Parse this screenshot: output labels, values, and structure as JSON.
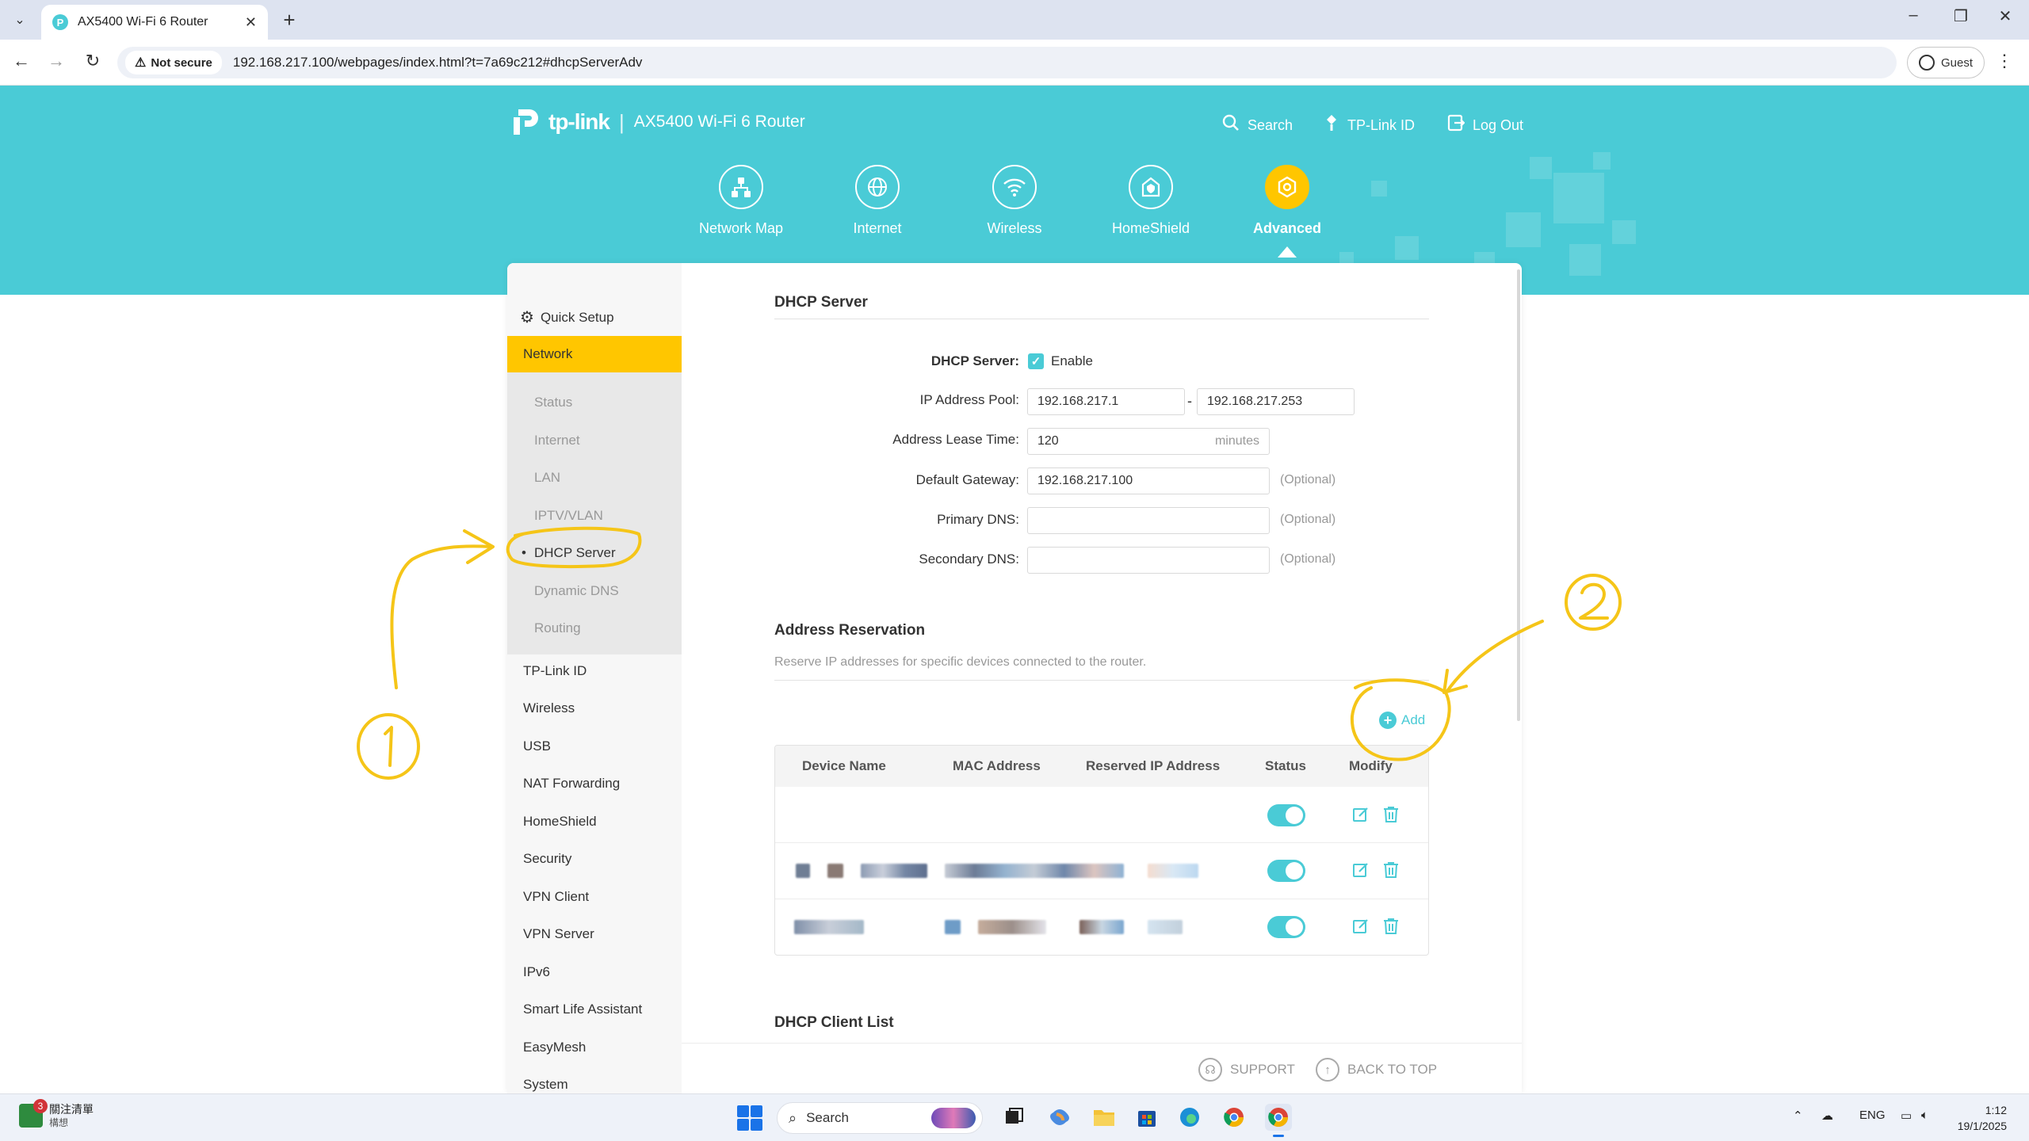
{
  "browser": {
    "tab_title": "AX5400 Wi-Fi 6 Router",
    "favicon_letter": "P",
    "security_label": "Not secure",
    "url": "192.168.217.100/webpages/index.html?t=7a69c212#dhcpServerAdv",
    "profile_label": "Guest"
  },
  "router": {
    "brand": "tp-link",
    "model": "AX5400 Wi-Fi 6 Router",
    "header_links": {
      "search": "Search",
      "tplink_id": "TP-Link ID",
      "logout": "Log Out"
    },
    "nav": [
      {
        "label": "Network Map",
        "icon": "network-map-icon"
      },
      {
        "label": "Internet",
        "icon": "globe-icon"
      },
      {
        "label": "Wireless",
        "icon": "wifi-icon"
      },
      {
        "label": "HomeShield",
        "icon": "homeshield-icon"
      },
      {
        "label": "Advanced",
        "icon": "advanced-gear-icon",
        "active": true
      }
    ],
    "accent_color": "#4acbd6",
    "highlight_color": "#ffc600"
  },
  "sidebar": {
    "quick_setup": "Quick Setup",
    "network": "Network",
    "network_sub": [
      "Status",
      "Internet",
      "LAN",
      "IPTV/VLAN",
      "DHCP Server",
      "Dynamic DNS",
      "Routing"
    ],
    "active_sub": "DHCP Server",
    "items": [
      "TP-Link ID",
      "Wireless",
      "USB",
      "NAT Forwarding",
      "HomeShield",
      "Security",
      "VPN Client",
      "VPN Server",
      "IPv6",
      "Smart Life Assistant",
      "EasyMesh",
      "System"
    ]
  },
  "dhcp": {
    "title": "DHCP Server",
    "server_label": "DHCP Server:",
    "enable_label": "Enable",
    "enabled": true,
    "pool_label": "IP Address Pool:",
    "pool_start": "192.168.217.1",
    "pool_dash": "-",
    "pool_end": "192.168.217.253",
    "lease_label": "Address Lease Time:",
    "lease_value": "120",
    "lease_unit": "minutes",
    "gateway_label": "Default Gateway:",
    "gateway_value": "192.168.217.100",
    "primary_dns_label": "Primary DNS:",
    "primary_dns_value": "",
    "secondary_dns_label": "Secondary DNS:",
    "secondary_dns_value": "",
    "optional": "(Optional)"
  },
  "reservation": {
    "title": "Address Reservation",
    "description": "Reserve IP addresses for specific devices connected to the router.",
    "add_label": "Add",
    "columns": [
      "Device Name",
      "MAC Address",
      "Reserved IP Address",
      "Status",
      "Modify"
    ],
    "row_status_on": [
      true,
      true,
      true
    ]
  },
  "client_list": {
    "title": "DHCP Client List"
  },
  "footer": {
    "support": "SUPPORT",
    "back_to_top": "BACK TO TOP"
  },
  "annotations": {
    "mark_1": "1",
    "mark_2": "2",
    "color": "#f5c518"
  },
  "taskbar": {
    "news_title": "關注清單",
    "news_sub": "構想",
    "news_badge": "3",
    "search_label": "Search",
    "lang": "ENG",
    "time": "1:12",
    "date": "19/1/2025"
  }
}
